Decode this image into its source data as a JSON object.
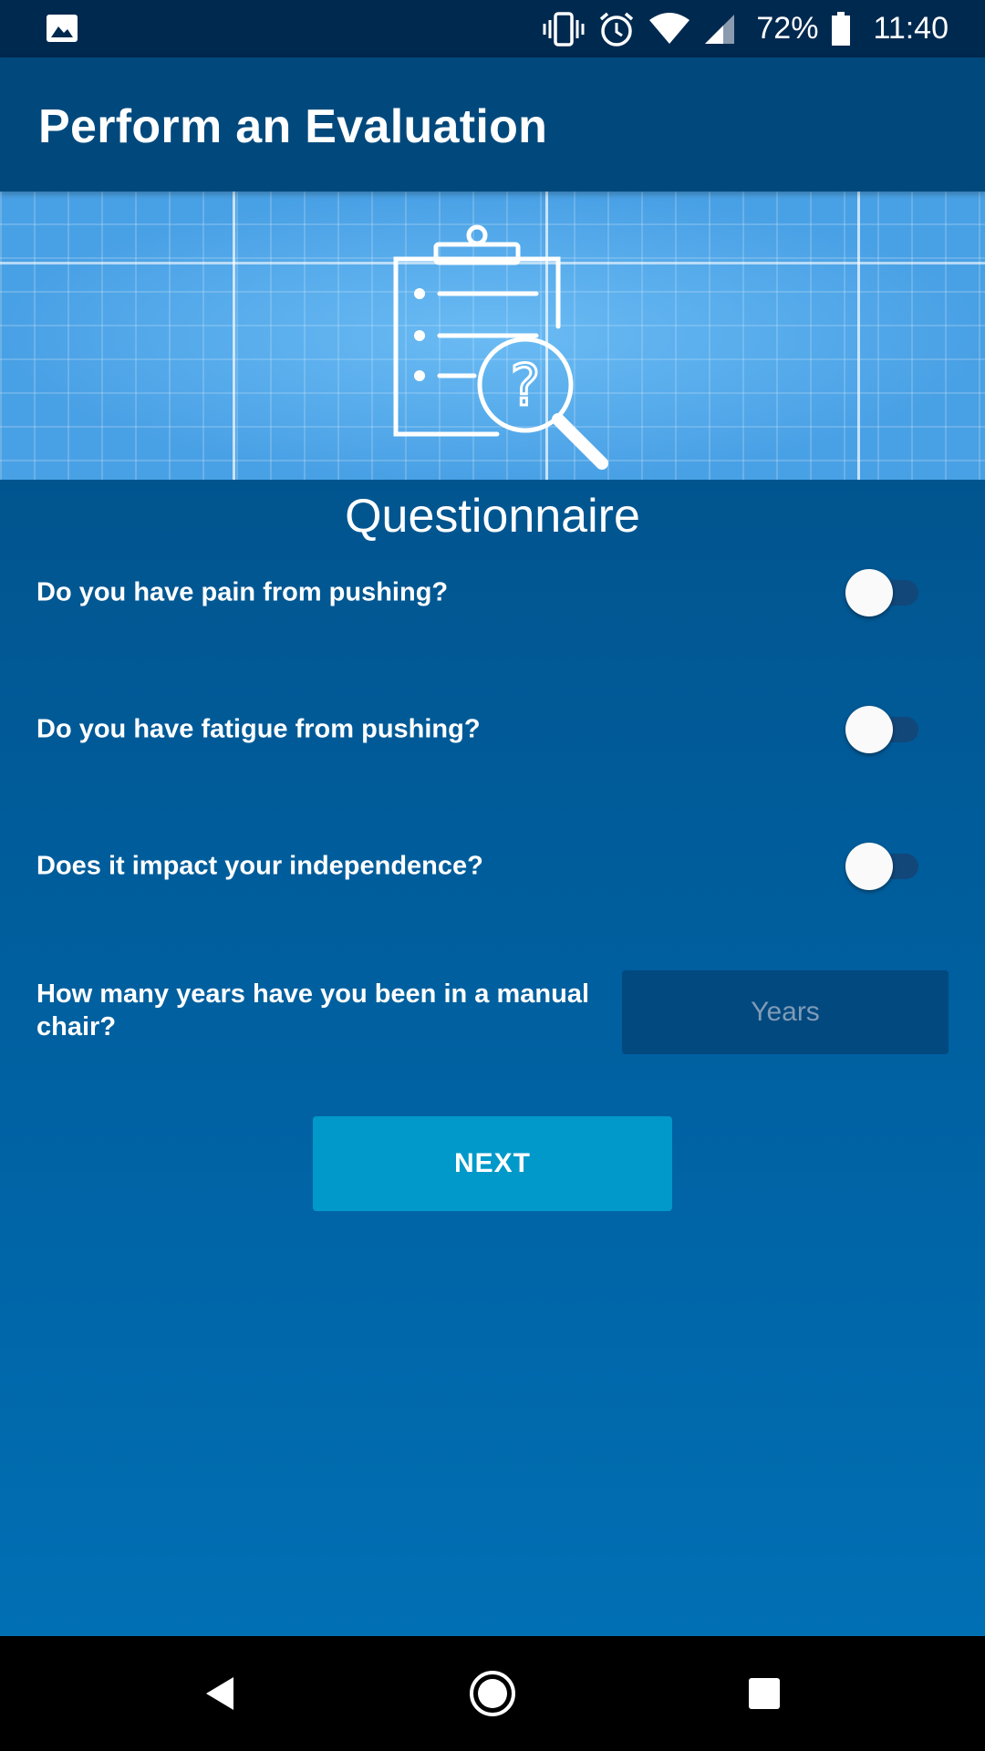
{
  "status_bar": {
    "battery_percent": "72%",
    "time": "11:40",
    "icons": [
      "image-icon",
      "vibrate-icon",
      "alarm-icon",
      "wifi-icon",
      "signal-icon",
      "battery-icon"
    ]
  },
  "app_bar": {
    "title": "Perform an Evaluation"
  },
  "banner": {
    "icon": "clipboard-search-icon",
    "icon_glyph": "?"
  },
  "questionnaire": {
    "title": "Questionnaire",
    "questions": [
      {
        "label": "Do you have pain from pushing?",
        "checked": false
      },
      {
        "label": "Do you have fatigue from pushing?",
        "checked": false
      },
      {
        "label": "Does it impact your independence?",
        "checked": false
      }
    ],
    "years_question": "How many years have you been in a manual chair?",
    "years_input": {
      "value": "",
      "placeholder": "Years"
    },
    "next_label": "NEXT"
  },
  "nav_bar": {
    "icons": [
      "back-icon",
      "home-icon",
      "recents-icon"
    ]
  },
  "colors": {
    "status_bar": "#00294f",
    "app_bar": "#01497c",
    "background_top": "#01558f",
    "background_bottom": "#016fb4",
    "button": "#0199c9",
    "input_bg": "#02497f"
  }
}
